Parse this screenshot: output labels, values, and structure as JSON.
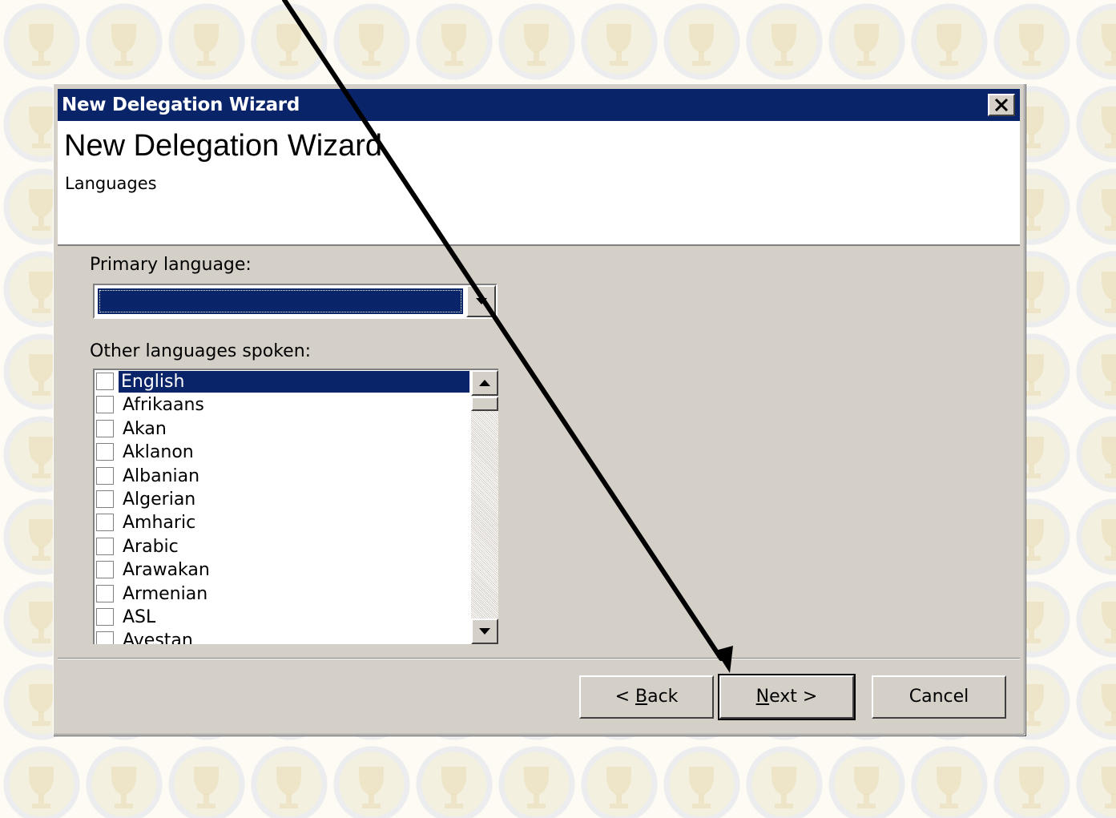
{
  "window": {
    "title": "New Delegation Wizard",
    "close_icon": "close-icon"
  },
  "header": {
    "title": "New Delegation Wizard",
    "subtitle": "Languages"
  },
  "primary_language": {
    "label": "Primary language:",
    "value": ""
  },
  "other_languages": {
    "label": "Other languages spoken:",
    "items": [
      {
        "label": "English",
        "checked": false,
        "selected": true
      },
      {
        "label": "Afrikaans",
        "checked": false,
        "selected": false
      },
      {
        "label": "Akan",
        "checked": false,
        "selected": false
      },
      {
        "label": "Aklanon",
        "checked": false,
        "selected": false
      },
      {
        "label": "Albanian",
        "checked": false,
        "selected": false
      },
      {
        "label": "Algerian",
        "checked": false,
        "selected": false
      },
      {
        "label": "Amharic",
        "checked": false,
        "selected": false
      },
      {
        "label": "Arabic",
        "checked": false,
        "selected": false
      },
      {
        "label": "Arawakan",
        "checked": false,
        "selected": false
      },
      {
        "label": "Armenian",
        "checked": false,
        "selected": false
      },
      {
        "label": "ASL",
        "checked": false,
        "selected": false
      },
      {
        "label": "Avestan",
        "checked": false,
        "selected": false
      }
    ]
  },
  "buttons": {
    "back": {
      "prefix": "< ",
      "mnemonic": "B",
      "rest": "ack"
    },
    "next": {
      "prefix": "",
      "mnemonic": "N",
      "rest": "ext >"
    },
    "cancel": {
      "label": "Cancel"
    }
  },
  "colors": {
    "titlebar": "#0a246a",
    "dialog_face": "#d4d0c8",
    "selection": "#0a246a"
  }
}
